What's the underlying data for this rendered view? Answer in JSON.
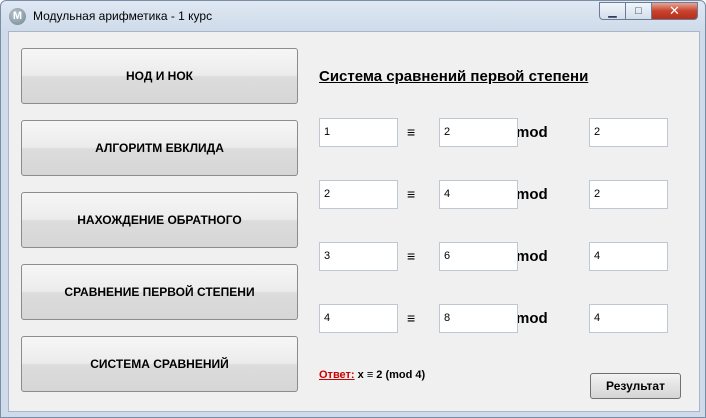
{
  "window": {
    "title": "Модульная арифметика - 1 курс",
    "icon_letter": "M",
    "minimize_glyph": "▁",
    "maximize_glyph": "□",
    "close_glyph": "✕"
  },
  "sidebar": {
    "items": [
      {
        "label": "НОД И НОК"
      },
      {
        "label": "АЛГОРИТМ ЕВКЛИДА"
      },
      {
        "label": "НАХОЖДЕНИЕ ОБРАТНОГО"
      },
      {
        "label": "СРАВНЕНИЕ ПЕРВОЙ СТЕПЕНИ"
      },
      {
        "label": "СИСТЕМА СРАВНЕНИЙ"
      }
    ]
  },
  "main": {
    "heading": "Система сравнений первой степени",
    "equiv_symbol": "≡",
    "mod_label": "mod",
    "rows": [
      {
        "a": "1",
        "b": "2",
        "m": "2"
      },
      {
        "a": "2",
        "b": "4",
        "m": "2"
      },
      {
        "a": "3",
        "b": "6",
        "m": "4"
      },
      {
        "a": "4",
        "b": "8",
        "m": "4"
      }
    ],
    "answer_label": "Ответ:",
    "answer_value": "x ≡ 2 (mod 4)",
    "result_button": "Результат"
  }
}
